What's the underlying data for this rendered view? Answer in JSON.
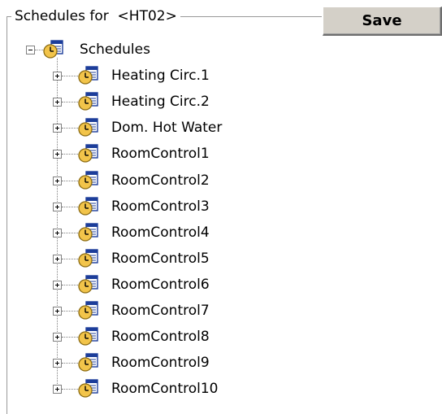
{
  "group": {
    "title": "Schedules for  <HT02>"
  },
  "toolbar": {
    "save_label": "Save"
  },
  "tree": {
    "root": {
      "label": "Schedules",
      "expander": "minus",
      "icon": "schedule-clock-calendar-icon"
    },
    "children": [
      {
        "label": "Heating Circ.1",
        "expander": "plus",
        "icon": "schedule-clock-calendar-icon"
      },
      {
        "label": "Heating Circ.2",
        "expander": "plus",
        "icon": "schedule-clock-calendar-icon"
      },
      {
        "label": "Dom. Hot Water",
        "expander": "plus",
        "icon": "schedule-clock-calendar-icon"
      },
      {
        "label": "RoomControl1",
        "expander": "plus",
        "icon": "schedule-clock-calendar-icon"
      },
      {
        "label": "RoomControl2",
        "expander": "plus",
        "icon": "schedule-clock-calendar-icon"
      },
      {
        "label": "RoomControl3",
        "expander": "plus",
        "icon": "schedule-clock-calendar-icon"
      },
      {
        "label": "RoomControl4",
        "expander": "plus",
        "icon": "schedule-clock-calendar-icon"
      },
      {
        "label": "RoomControl5",
        "expander": "plus",
        "icon": "schedule-clock-calendar-icon"
      },
      {
        "label": "RoomControl6",
        "expander": "plus",
        "icon": "schedule-clock-calendar-icon"
      },
      {
        "label": "RoomControl7",
        "expander": "plus",
        "icon": "schedule-clock-calendar-icon"
      },
      {
        "label": "RoomControl8",
        "expander": "plus",
        "icon": "schedule-clock-calendar-icon"
      },
      {
        "label": "RoomControl9",
        "expander": "plus",
        "icon": "schedule-clock-calendar-icon"
      },
      {
        "label": "RoomControl10",
        "expander": "plus",
        "icon": "schedule-clock-calendar-icon"
      }
    ]
  },
  "colors": {
    "clock_face": "#f2c44a",
    "clock_rim": "#8a6a10",
    "calendar_header": "#1c3d9a",
    "calendar_body": "#ffffff",
    "button_face": "#d4d0c8"
  }
}
